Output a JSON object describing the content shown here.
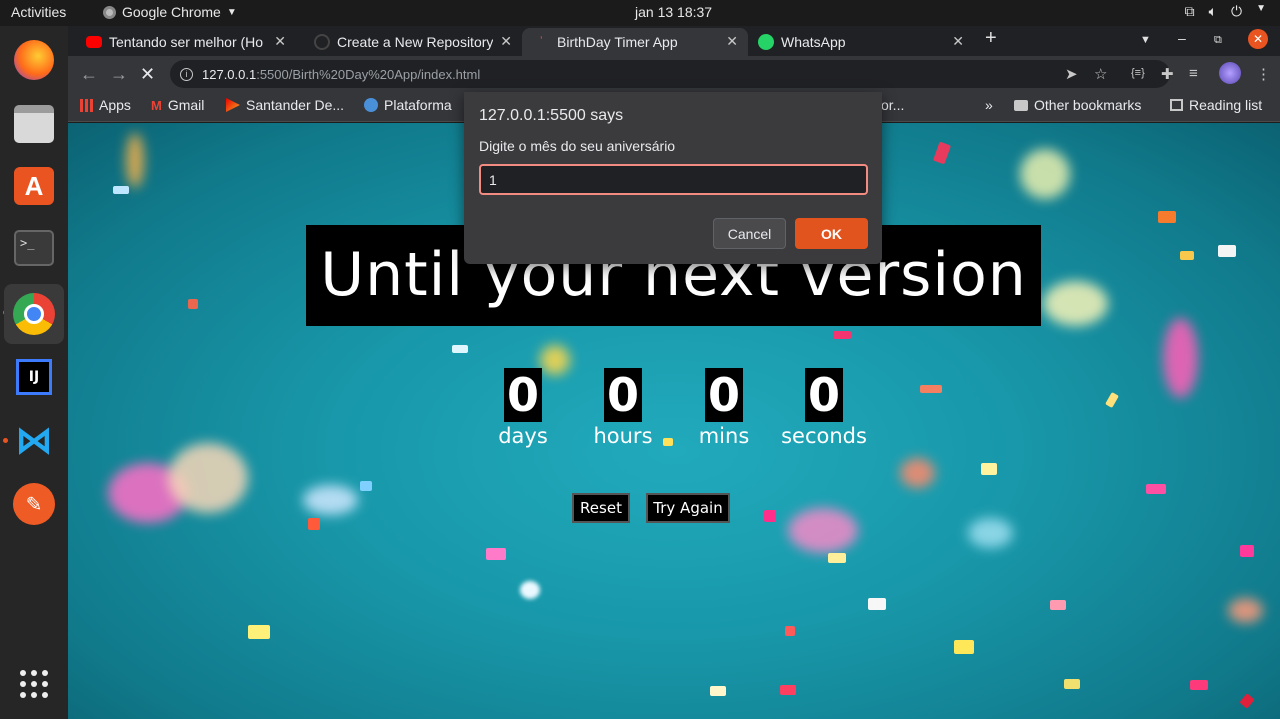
{
  "topbar": {
    "activities": "Activities",
    "app_name": "Google Chrome",
    "clock": "jan 13  18:37"
  },
  "tabs": [
    {
      "label": "Tentando ser melhor (Ho",
      "icon": "youtube-icon"
    },
    {
      "label": "Create a New Repository",
      "icon": "github-icon"
    },
    {
      "label": "BirthDay Timer App",
      "icon": "page-icon"
    },
    {
      "label": "WhatsApp",
      "icon": "whatsapp-icon"
    }
  ],
  "address": {
    "host": "127.0.0.1",
    "path": ":5500/Birth%20Day%20App/index.html"
  },
  "bookmarks": {
    "items": [
      "Apps",
      "Gmail",
      "Santander De...",
      "Plataforma"
    ],
    "overflow_fragment": "or...",
    "more": "»",
    "other": "Other bookmarks",
    "reading": "Reading list"
  },
  "page": {
    "headline": "Until your next version",
    "counters": [
      {
        "value": "0",
        "unit": "days"
      },
      {
        "value": "0",
        "unit": "hours"
      },
      {
        "value": "0",
        "unit": "mins"
      },
      {
        "value": "0",
        "unit": "seconds"
      }
    ],
    "reset_label": "Reset",
    "try_again_label": "Try Again"
  },
  "dialog": {
    "title": "127.0.0.1:5500 says",
    "message": "Digite o mês do seu aniversário",
    "input_value": "1",
    "cancel_label": "Cancel",
    "ok_label": "OK"
  },
  "colors": {
    "accent": "#e2541d",
    "page_bg": "#1898aa",
    "input_border": "#f28b82"
  }
}
